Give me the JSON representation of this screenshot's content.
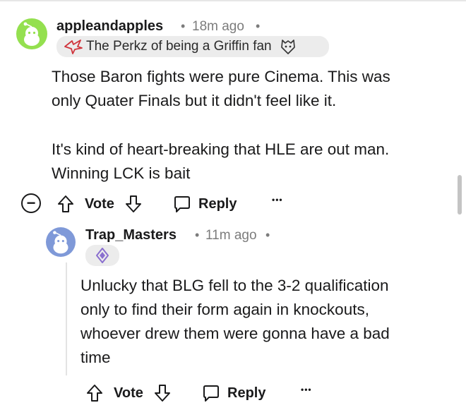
{
  "comment": {
    "username": "appleandapples",
    "separator": "•",
    "time": "18m ago",
    "flair": "The Perkz of being a Griffin fan",
    "paragraphs": [
      "Those Baron fights were pure Cinema. This was",
      "only Quater Finals but it didn't feel like it.",
      "It's kind of heart-breaking that HLE are out man.",
      "Winning LCK is bait"
    ],
    "actions": {
      "vote": "Vote",
      "reply": "Reply",
      "more": "•••"
    },
    "collapse_symbol": "−"
  },
  "reply": {
    "username": "Trap_Masters",
    "separator": "•",
    "time": "11m ago",
    "lines": [
      "Unlucky that BLG fell to the 3-2 qualification",
      "only to find their form again in knockouts,",
      "whoever drew them were gonna have a bad",
      "time"
    ],
    "actions": {
      "vote": "Vote",
      "reply": "Reply",
      "more": "•••"
    }
  },
  "colors": {
    "avatar1_bg": "#94e04f",
    "avatar2_bg": "#7f99d8",
    "text": "#1a1a1b",
    "meta": "#7c7c7c",
    "flair_bg": "#ececec",
    "flair_icon_red": "#d0343c",
    "flair_icon_purple": "#8a6fcf"
  },
  "icons": [
    "snoo-avatar-icon",
    "griffin-flair-icon",
    "g2-flair-icon",
    "blg-flair-icon",
    "upvote-icon",
    "downvote-icon",
    "reply-bubble-icon",
    "collapse-icon",
    "more-icon"
  ]
}
